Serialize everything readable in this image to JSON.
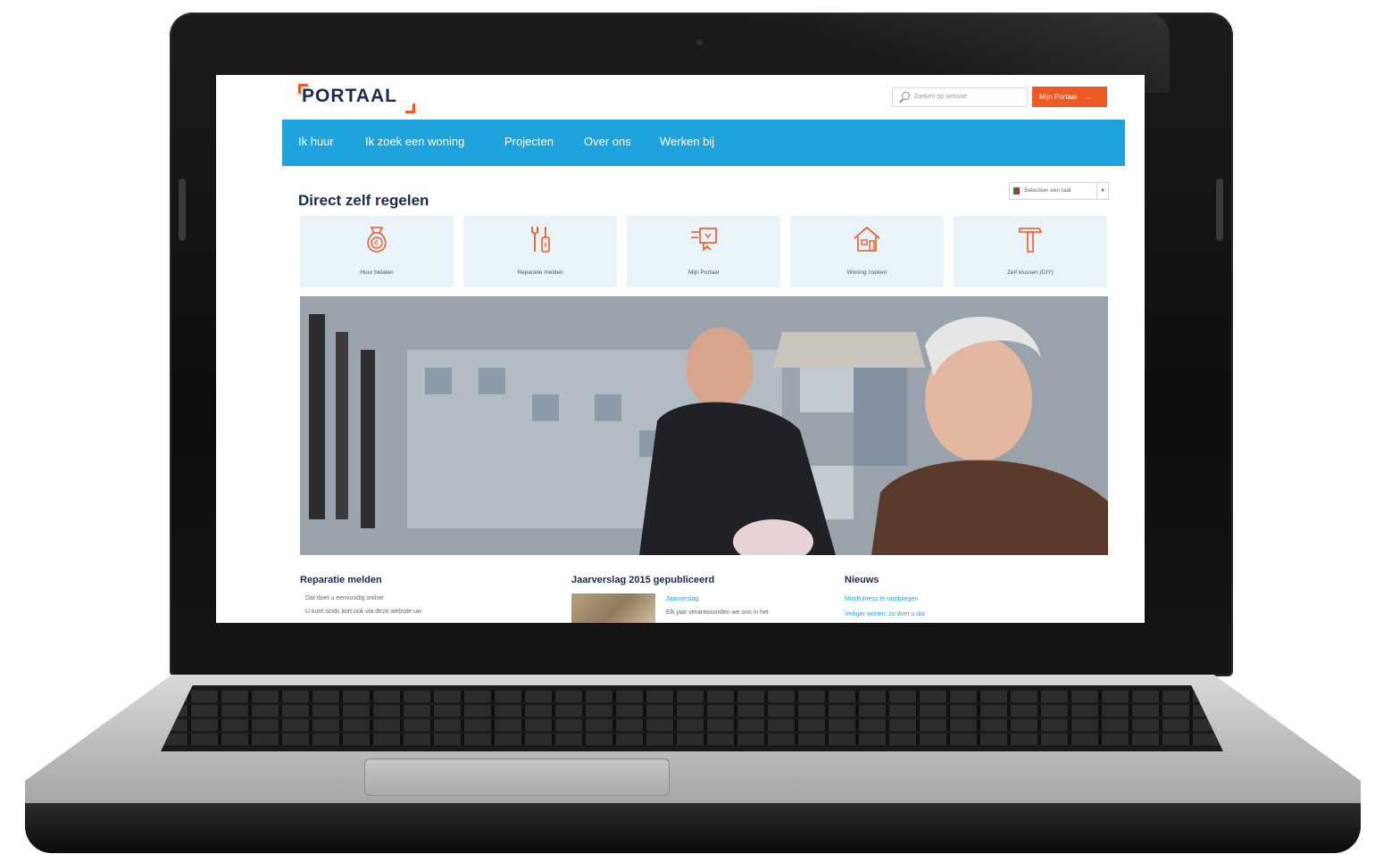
{
  "brand": {
    "logo_text": "PORTAAL",
    "accent": "#ee5a24",
    "nav_color": "#1fa3dc",
    "navy": "#1d2a4d"
  },
  "header": {
    "search_placeholder": "Zoeken op website",
    "account_button": "Mijn Portaal",
    "account_arrow": "→"
  },
  "nav": {
    "items": [
      "Ik huur",
      "Ik zoek een woning",
      "Projecten",
      "Over ons",
      "Werken bij"
    ]
  },
  "main": {
    "title": "Direct zelf regelen",
    "language_select": "Selecteer een taal",
    "language_caret": "▼",
    "tiles": [
      {
        "label": "Huur betalen",
        "icon": "money-bag-icon"
      },
      {
        "label": "Reparatie melden",
        "icon": "tools-icon"
      },
      {
        "label": "Mijn Portaal",
        "icon": "portal-screen-icon"
      },
      {
        "label": "Woning zoeken",
        "icon": "house-icon"
      },
      {
        "label": "Zelf klussen (DIY)",
        "icon": "hammer-icon"
      }
    ]
  },
  "columns": {
    "repair": {
      "title": "Reparatie melden",
      "line1": "Dat doet u eenvoudig online",
      "line2": "U kunt sinds kort ook via deze website uw"
    },
    "report": {
      "title": "Jaarverslag 2015 gepubliceerd",
      "link": "Jaarverslag",
      "text": "Elk jaar verantwoorden we ons in het"
    },
    "news": {
      "title": "Nieuws",
      "item1": "Mindfulness te raadplegen",
      "item2": "Veiliger wonen: zo doet u dat"
    }
  }
}
